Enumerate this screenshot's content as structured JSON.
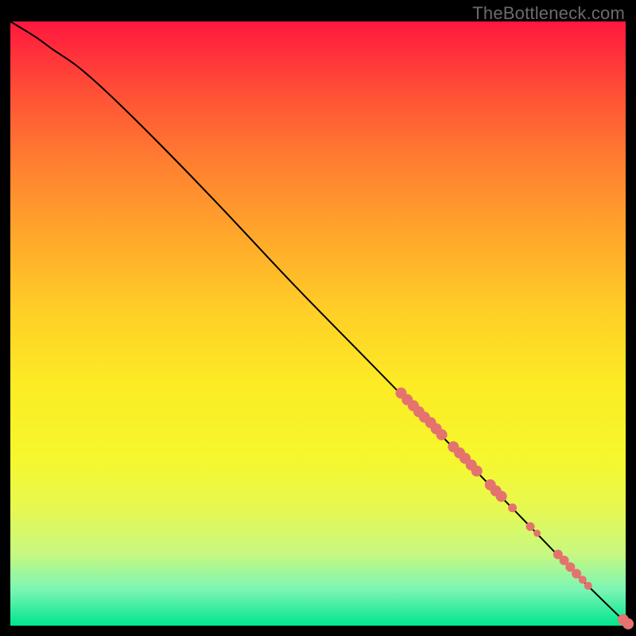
{
  "attribution": "TheBottleneck.com",
  "chart_data": {
    "type": "line",
    "title": "",
    "xlabel": "",
    "ylabel": "",
    "xlim": [
      0,
      100
    ],
    "ylim": [
      0,
      100
    ],
    "grid": false,
    "legend": false,
    "series": [
      {
        "name": "curve",
        "style": "line",
        "points": [
          {
            "x": 0,
            "y": 100
          },
          {
            "x": 4,
            "y": 97.5
          },
          {
            "x": 7,
            "y": 95.3
          },
          {
            "x": 11,
            "y": 92.5
          },
          {
            "x": 16,
            "y": 88.0
          },
          {
            "x": 24,
            "y": 80.0
          },
          {
            "x": 34,
            "y": 69.5
          },
          {
            "x": 46,
            "y": 56.5
          },
          {
            "x": 58,
            "y": 44.0
          },
          {
            "x": 70,
            "y": 31.5
          },
          {
            "x": 82,
            "y": 19.0
          },
          {
            "x": 92,
            "y": 8.5
          },
          {
            "x": 100,
            "y": 0.5
          }
        ]
      },
      {
        "name": "dots",
        "style": "scatter",
        "points": [
          {
            "x": 63.5,
            "y": 38.5,
            "r": 7
          },
          {
            "x": 64.5,
            "y": 37.4,
            "r": 7
          },
          {
            "x": 65.5,
            "y": 36.4,
            "r": 7
          },
          {
            "x": 66.4,
            "y": 35.4,
            "r": 7
          },
          {
            "x": 67.3,
            "y": 34.5,
            "r": 7
          },
          {
            "x": 68.3,
            "y": 33.6,
            "r": 7
          },
          {
            "x": 69.2,
            "y": 32.6,
            "r": 7
          },
          {
            "x": 70.1,
            "y": 31.6,
            "r": 7
          },
          {
            "x": 72.0,
            "y": 29.6,
            "r": 7
          },
          {
            "x": 73.0,
            "y": 28.6,
            "r": 7
          },
          {
            "x": 73.9,
            "y": 27.7,
            "r": 7
          },
          {
            "x": 74.9,
            "y": 26.6,
            "r": 7
          },
          {
            "x": 75.8,
            "y": 25.6,
            "r": 7
          },
          {
            "x": 78.0,
            "y": 23.3,
            "r": 7
          },
          {
            "x": 78.9,
            "y": 22.3,
            "r": 7
          },
          {
            "x": 79.8,
            "y": 21.4,
            "r": 7
          },
          {
            "x": 81.6,
            "y": 19.5,
            "r": 5.5
          },
          {
            "x": 84.5,
            "y": 16.4,
            "r": 5.5
          },
          {
            "x": 85.6,
            "y": 15.3,
            "r": 4.5
          },
          {
            "x": 89.0,
            "y": 11.8,
            "r": 6
          },
          {
            "x": 90.0,
            "y": 10.8,
            "r": 6
          },
          {
            "x": 91.0,
            "y": 9.7,
            "r": 6
          },
          {
            "x": 92.0,
            "y": 8.6,
            "r": 6
          },
          {
            "x": 93.0,
            "y": 7.6,
            "r": 5
          },
          {
            "x": 93.9,
            "y": 6.6,
            "r": 5
          },
          {
            "x": 99.6,
            "y": 1.0,
            "r": 7
          },
          {
            "x": 100.4,
            "y": 0.3,
            "r": 7
          }
        ]
      }
    ]
  }
}
